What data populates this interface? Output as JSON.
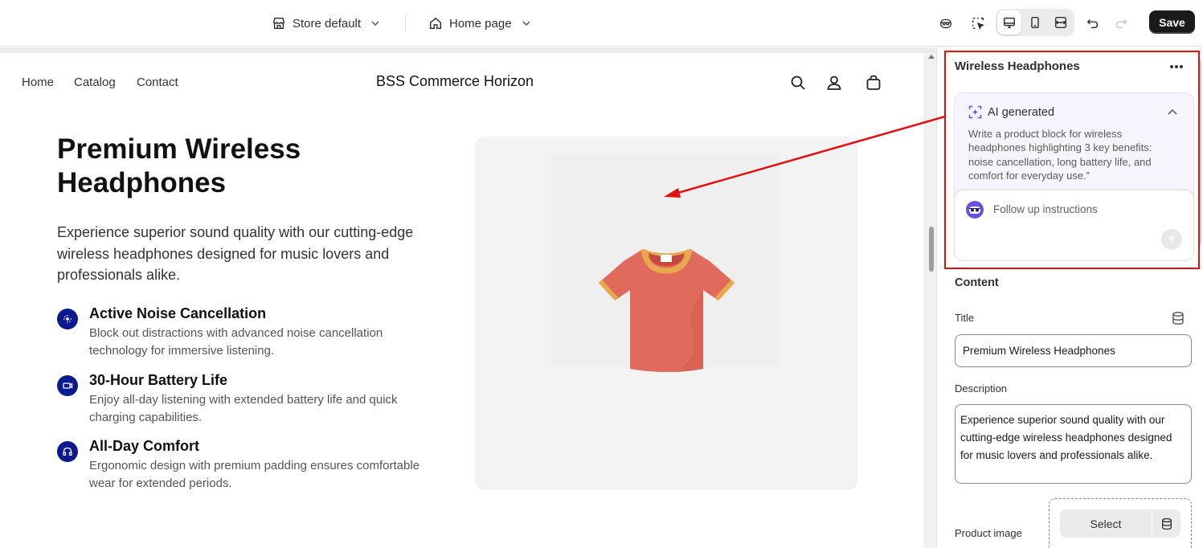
{
  "topbar": {
    "store_selector": "Store default",
    "page_selector": "Home page",
    "save_label": "Save"
  },
  "storefront": {
    "nav": [
      "Home",
      "Catalog",
      "Contact"
    ],
    "store_name": "BSS Commerce Horizon",
    "hero": {
      "title": "Premium Wireless Headphones",
      "description": "Experience superior sound quality with our cutting-edge wireless headphones designed for music lovers and professionals alike."
    },
    "features": [
      {
        "title": "Active Noise Cancellation",
        "description": "Block out distractions with advanced noise cancellation technology for immersive listening.",
        "icon": "noise-icon"
      },
      {
        "title": "30-Hour Battery Life",
        "description": "Enjoy all-day listening with extended battery life and quick charging capabilities.",
        "icon": "battery-icon"
      },
      {
        "title": "All-Day Comfort",
        "description": "Ergonomic design with premium padding ensures comfortable wear for extended periods.",
        "icon": "headphones-icon"
      }
    ],
    "product_image": "tshirt-image"
  },
  "sidebar": {
    "block_title": "Wireless Headphones",
    "ai": {
      "title": "AI generated",
      "prompt": "Write a product block for wireless headphones highlighting 3 key benefits: noise cancellation, long battery life, and comfort for everyday use.”",
      "follow_placeholder": "Follow up instructions"
    },
    "content_label": "Content",
    "title_label": "Title",
    "title_value": "Premium Wireless Headphones",
    "description_label": "Description",
    "description_value": "Experience superior sound quality with our cutting-edge wireless headphones designed for music lovers and professionals alike.",
    "product_image_label": "Product image",
    "select_label": "Select"
  },
  "colors": {
    "accent_navy": "#0b1a8e",
    "annotation_red": "#e0110f",
    "ai_purple": "#6b4fe0"
  }
}
